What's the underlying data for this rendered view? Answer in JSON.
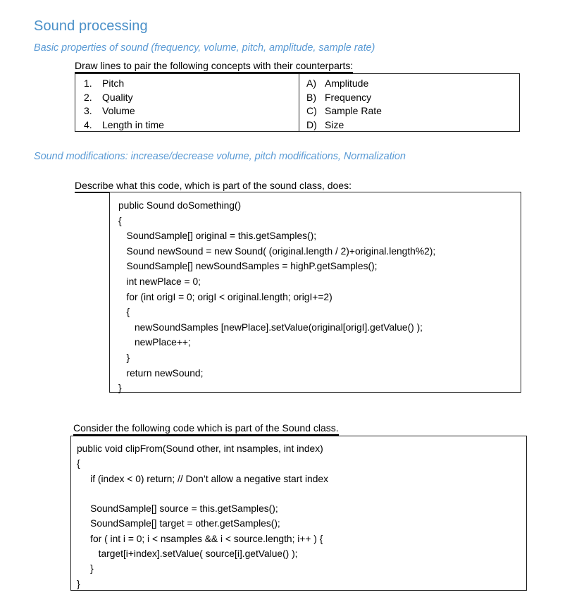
{
  "document": {
    "title": "Sound processing",
    "sections": [
      {
        "subtitle": "Basic properties of sound (frequency, volume, pitch, amplitude, sample rate)",
        "prompt": "Draw lines to pair the following concepts with their counterparts:"
      },
      {
        "subtitle": "Sound modifications: increase/decrease volume, pitch modifications, Normalization"
      }
    ]
  },
  "matching_table": {
    "left_column": [
      {
        "marker": "1.",
        "text": "Pitch"
      },
      {
        "marker": "2.",
        "text": "Quality"
      },
      {
        "marker": "3.",
        "text": "Volume"
      },
      {
        "marker": "4.",
        "text": "Length in time"
      }
    ],
    "right_column": [
      {
        "marker": "A)",
        "text": "Amplitude"
      },
      {
        "marker": "B)",
        "text": "Frequency"
      },
      {
        "marker": "C)",
        "text": "Sample Rate"
      },
      {
        "marker": "D)",
        "text": "Size"
      }
    ]
  },
  "question_1": {
    "prompt": "Describe what this code, which is part of the sound class, does:",
    "code_lines": [
      "public Sound doSomething()",
      "{",
      "   SoundSample[] original = this.getSamples();",
      "   Sound newSound = new Sound( (original.length / 2)+original.length%2);",
      "   SoundSample[] newSoundSamples = highP.getSamples();",
      "   int newPlace = 0;",
      "   for (int origI = 0; origI < original.length; origI+=2)",
      "   {",
      "      newSoundSamples [newPlace].setValue(original[origI].getValue() );",
      "      newPlace++;",
      "   }",
      "   return newSound;",
      "}"
    ]
  },
  "question_2": {
    "prompt": "Consider the following code which is part of the Sound class.",
    "code_lines": [
      "public void clipFrom(Sound other, int nsamples, int index)",
      "{",
      "     if (index < 0) return; // Don’t allow a negative start index",
      "",
      "     SoundSample[] source = this.getSamples();",
      "     SoundSample[] target = other.getSamples();",
      "     for ( int i = 0; i < nsamples && i < source.length; i++ ) {",
      "        target[i+index].setValue( source[i].getValue() );",
      "     }",
      "}"
    ]
  },
  "colors": {
    "title_blue": "#4a90c8",
    "subtitle_blue": "#5b9bd5",
    "text_black": "#000000",
    "border": "#222222"
  }
}
